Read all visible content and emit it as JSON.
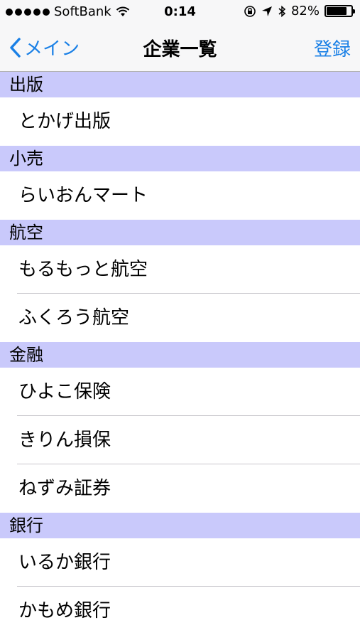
{
  "status_bar": {
    "carrier": "SoftBank",
    "time": "0:14",
    "battery_percent_label": "82%",
    "battery_level": 0.82
  },
  "nav": {
    "back_label": "メイン",
    "title": "企業一覧",
    "register_label": "登録"
  },
  "colors": {
    "accent": "#1a80e6",
    "section_header_bg": "#c9c9fb",
    "separator": "#c8c7cc"
  },
  "sections": [
    {
      "header": "出版",
      "items": [
        "とかげ出版"
      ]
    },
    {
      "header": "小売",
      "items": [
        "らいおんマート"
      ]
    },
    {
      "header": "航空",
      "items": [
        "もるもっと航空",
        "ふくろう航空"
      ]
    },
    {
      "header": "金融",
      "items": [
        "ひよこ保険",
        "きりん損保",
        "ねずみ証券"
      ]
    },
    {
      "header": "銀行",
      "items": [
        "いるか銀行",
        "かもめ銀行"
      ]
    }
  ]
}
